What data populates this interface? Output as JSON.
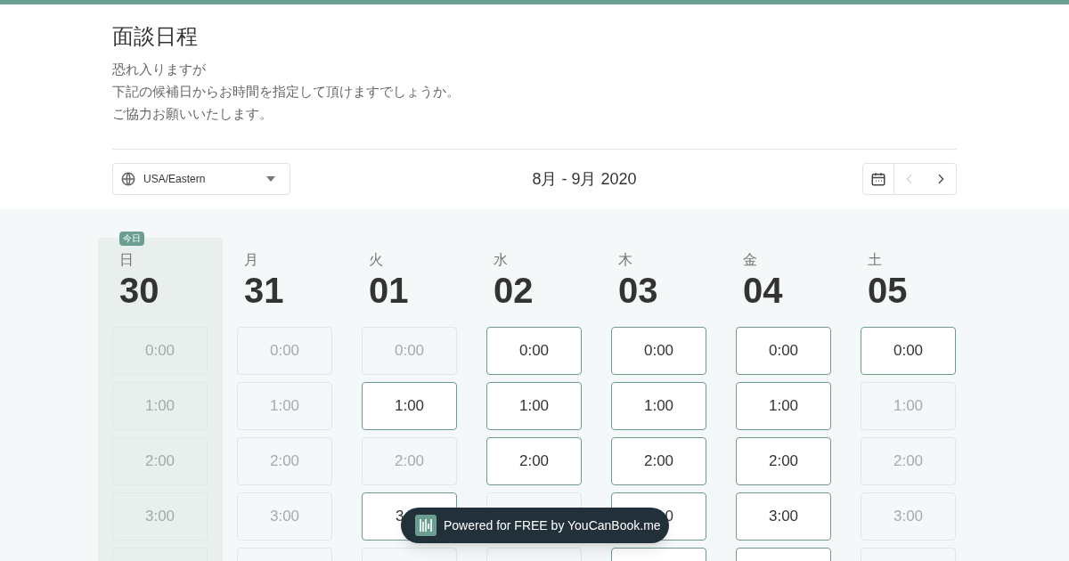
{
  "title": "面談日程",
  "message": [
    "恐れ入りますが",
    "下記の候補日からお時間を指定して頂けますでしょうか。",
    "ご協力お願いいたします。"
  ],
  "timezone": {
    "value": "USA/Eastern"
  },
  "range": "8月 - 9月 2020",
  "nav": [
    {
      "kind": "calendar",
      "disabled": false
    },
    {
      "kind": "prev",
      "disabled": true
    },
    {
      "kind": "next",
      "disabled": false
    }
  ],
  "days": [
    {
      "weekday": "日",
      "date": "30",
      "today": true,
      "badge": "今日",
      "slots": [
        {
          "time": "0:00",
          "available": false
        },
        {
          "time": "1:00",
          "available": false
        },
        {
          "time": "2:00",
          "available": false
        },
        {
          "time": "3:00",
          "available": false
        },
        {
          "available": false
        }
      ]
    },
    {
      "weekday": "月",
      "date": "31",
      "today": false,
      "slots": [
        {
          "time": "0:00",
          "available": false
        },
        {
          "time": "1:00",
          "available": false
        },
        {
          "time": "2:00",
          "available": false
        },
        {
          "time": "3:00",
          "available": false
        },
        {
          "available": false
        }
      ]
    },
    {
      "weekday": "火",
      "date": "01",
      "today": false,
      "slots": [
        {
          "time": "0:00",
          "available": false
        },
        {
          "time": "1:00",
          "available": true
        },
        {
          "time": "2:00",
          "available": false
        },
        {
          "time": "3",
          "available": true,
          "kind": "shows-start"
        },
        {
          "available": false
        }
      ]
    },
    {
      "weekday": "水",
      "date": "02",
      "today": false,
      "slots": [
        {
          "time": "0:00",
          "available": true
        },
        {
          "time": "1:00",
          "available": true
        },
        {
          "time": "2:00",
          "available": true
        },
        {
          "available": false
        },
        {
          "available": false
        }
      ]
    },
    {
      "weekday": "木",
      "date": "03",
      "today": false,
      "slots": [
        {
          "time": "0:00",
          "available": true
        },
        {
          "time": "1:00",
          "available": true
        },
        {
          "time": "2:00",
          "available": true
        },
        {
          "time": "0",
          "available": true,
          "kind": "shows-end"
        },
        {
          "available": true
        }
      ]
    },
    {
      "weekday": "金",
      "date": "04",
      "today": false,
      "slots": [
        {
          "time": "0:00",
          "available": true
        },
        {
          "time": "1:00",
          "available": true
        },
        {
          "time": "2:00",
          "available": true
        },
        {
          "time": "3:00",
          "available": true
        },
        {
          "available": true
        }
      ]
    },
    {
      "weekday": "土",
      "date": "05",
      "today": false,
      "slots": [
        {
          "time": "0:00",
          "available": true
        },
        {
          "time": "1:00",
          "available": false
        },
        {
          "time": "2:00",
          "available": false
        },
        {
          "time": "3:00",
          "available": false
        },
        {
          "available": false
        }
      ]
    }
  ],
  "powered_by": "Powered for FREE by YouCanBook.me"
}
